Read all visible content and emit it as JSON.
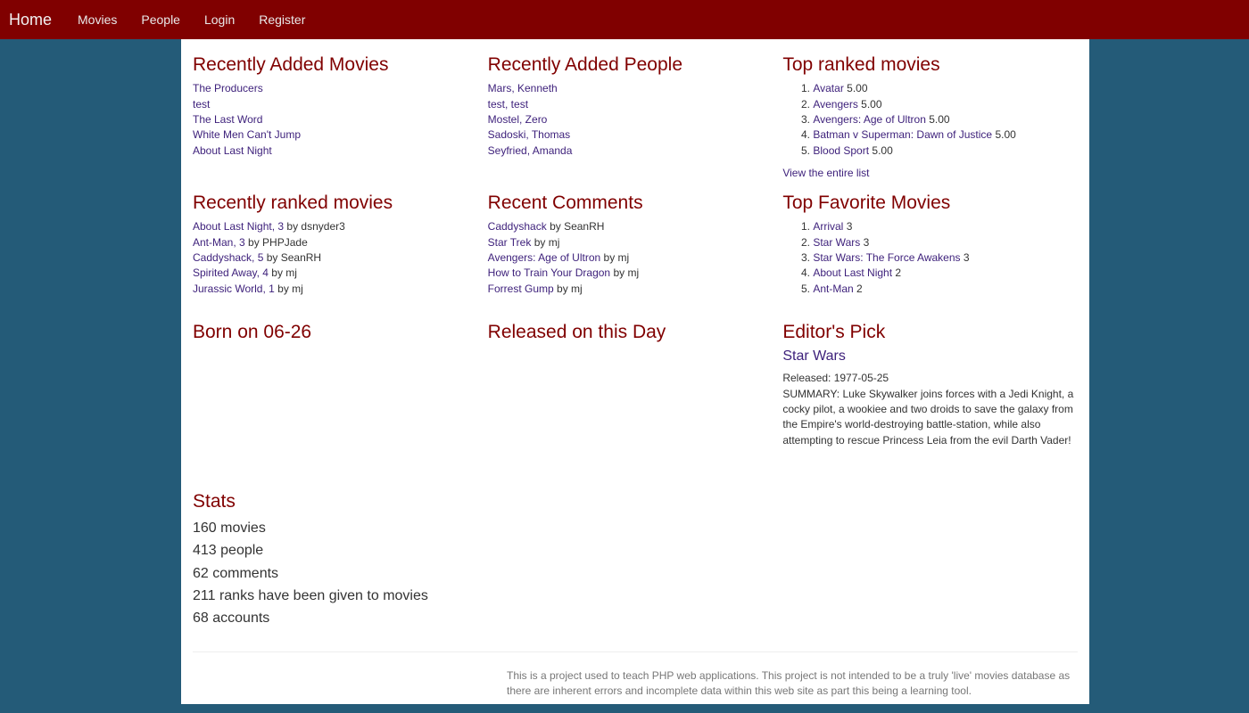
{
  "nav": {
    "brand": "Home",
    "items": [
      "Movies",
      "People",
      "Login",
      "Register"
    ]
  },
  "recent_movies": {
    "title": "Recently Added Movies",
    "items": [
      "The Producers",
      "test",
      "The Last Word",
      "White Men Can't Jump",
      "About Last Night"
    ]
  },
  "recent_people": {
    "title": "Recently Added People",
    "items": [
      "Mars, Kenneth",
      "test, test",
      "Mostel, Zero",
      "Sadoski, Thomas",
      "Seyfried, Amanda"
    ]
  },
  "top_ranked": {
    "title": "Top ranked movies",
    "items": [
      {
        "name": "Avatar",
        "score": "5.00"
      },
      {
        "name": "Avengers",
        "score": "5.00"
      },
      {
        "name": "Avengers: Age of Ultron",
        "score": "5.00"
      },
      {
        "name": "Batman v Superman: Dawn of Justice",
        "score": "5.00"
      },
      {
        "name": "Blood Sport",
        "score": "5.00"
      }
    ],
    "view_all": "View the entire list"
  },
  "recently_ranked": {
    "title": "Recently ranked movies",
    "items": [
      {
        "link": "About Last Night, 3",
        "by": "by dsnyder3"
      },
      {
        "link": "Ant-Man, 3",
        "by": "by PHPJade"
      },
      {
        "link": "Caddyshack, 5",
        "by": "by SeanRH"
      },
      {
        "link": "Spirited Away, 4",
        "by": "by mj"
      },
      {
        "link": "Jurassic World, 1",
        "by": "by mj"
      }
    ]
  },
  "recent_comments": {
    "title": "Recent Comments",
    "items": [
      {
        "link": "Caddyshack",
        "by": "by SeanRH"
      },
      {
        "link": "Star Trek",
        "by": "by mj"
      },
      {
        "link": "Avengers: Age of Ultron",
        "by": "by mj"
      },
      {
        "link": "How to Train Your Dragon",
        "by": "by mj"
      },
      {
        "link": "Forrest Gump",
        "by": "by mj"
      }
    ]
  },
  "top_favorite": {
    "title": "Top Favorite Movies",
    "items": [
      {
        "name": "Arrival",
        "count": "3"
      },
      {
        "name": "Star Wars",
        "count": "3"
      },
      {
        "name": "Star Wars: The Force Awakens",
        "count": "3"
      },
      {
        "name": "About Last Night",
        "count": "2"
      },
      {
        "name": "Ant-Man",
        "count": "2"
      }
    ]
  },
  "born": {
    "title": "Born on 06-26"
  },
  "released": {
    "title": "Released on this Day"
  },
  "editors_pick": {
    "title": "Editor's Pick",
    "movie": "Star Wars",
    "released": "Released: 1977-05-25",
    "summary": "SUMMARY: Luke Skywalker joins forces with a Jedi Knight, a cocky pilot, a wookiee and two droids to save the galaxy from the Empire's world-destroying battle-station, while also attempting to rescue Princess Leia from the evil Darth Vader!"
  },
  "stats": {
    "title": "Stats",
    "lines": [
      "160 movies",
      "413 people",
      "62 comments",
      "211 ranks have been given to movies",
      "68 accounts"
    ]
  },
  "footer": "This is a project used to teach PHP web applications. This project is not intended to be a truly 'live' movies database as there are inherent errors and incomplete data within this web site as part this being a learning tool."
}
